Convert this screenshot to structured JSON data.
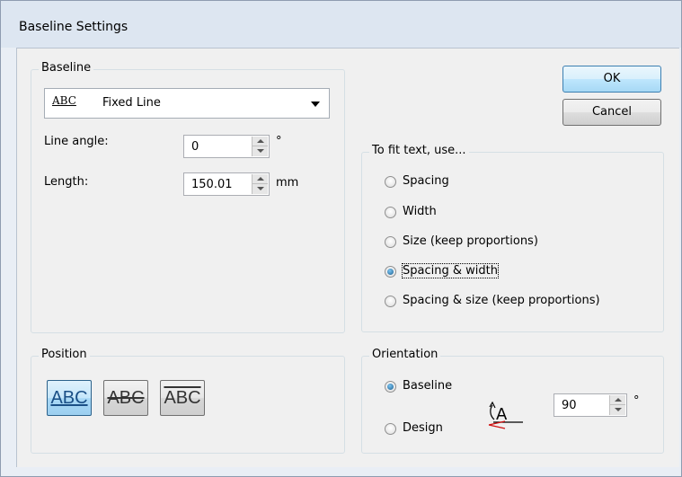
{
  "window": {
    "title": "Baseline Settings"
  },
  "baseline_group": {
    "label": "Baseline",
    "combo": {
      "icon_text": "ABC",
      "value": "Fixed Line"
    },
    "line_angle": {
      "label": "Line angle:",
      "value": "0",
      "unit": "°"
    },
    "length": {
      "label": "Length:",
      "value": "150.01",
      "unit": "mm"
    }
  },
  "buttons": {
    "ok": "OK",
    "cancel": "Cancel"
  },
  "fit_group": {
    "label": "To fit text, use...",
    "options": [
      {
        "label": "Spacing",
        "checked": false
      },
      {
        "label": "Width",
        "checked": false
      },
      {
        "label": "Size (keep proportions)",
        "checked": false
      },
      {
        "label": "Spacing & width",
        "checked": true
      },
      {
        "label": "Spacing & size (keep proportions)",
        "checked": false
      }
    ]
  },
  "position_group": {
    "label": "Position",
    "buttons": [
      {
        "text": "ABC",
        "style": "underline",
        "active": true
      },
      {
        "text": "ABC",
        "style": "strike",
        "active": false
      },
      {
        "text": "ABC",
        "style": "overline",
        "active": false
      }
    ]
  },
  "orientation_group": {
    "label": "Orientation",
    "options": [
      {
        "label": "Baseline",
        "checked": true
      },
      {
        "label": "Design",
        "checked": false
      }
    ],
    "angle": {
      "value": "90",
      "unit": "°"
    },
    "icon_text": "A"
  }
}
